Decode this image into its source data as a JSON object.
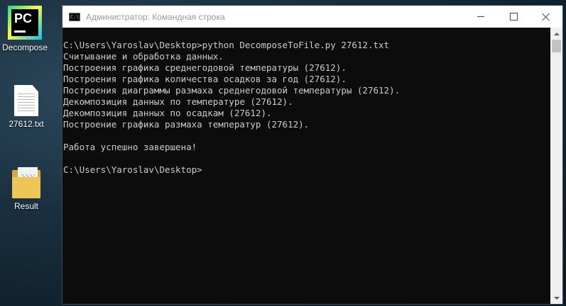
{
  "desktop": {
    "icons": [
      {
        "label": "Decompose"
      },
      {
        "label": "27612.txt"
      },
      {
        "label": "Result"
      }
    ]
  },
  "window": {
    "icon_text": "C:\\.",
    "title": "Администратор: Командная строка"
  },
  "console": {
    "lines": [
      "C:\\Users\\Yaroslav\\Desktop>python DecomposeToFile.py 27612.txt",
      "Считывание и обработка данных.",
      "Построения графика среднегодовой температуры (27612).",
      "Построения графика количества осадков за год (27612).",
      "Построения диаграммы размаха среднегодовой температуры (27612).",
      "Декомпозиция данных по температуре (27612).",
      "Декомпозиция данных по осадкам (27612).",
      "Построение графика размаха температур (27612).",
      "",
      "Работа успешно завершена!",
      "",
      "C:\\Users\\Yaroslav\\Desktop>"
    ]
  },
  "colors": {
    "console_background": "#0c0c0c",
    "console_text": "#cccccc",
    "titlebar_background": "#ffffff"
  }
}
